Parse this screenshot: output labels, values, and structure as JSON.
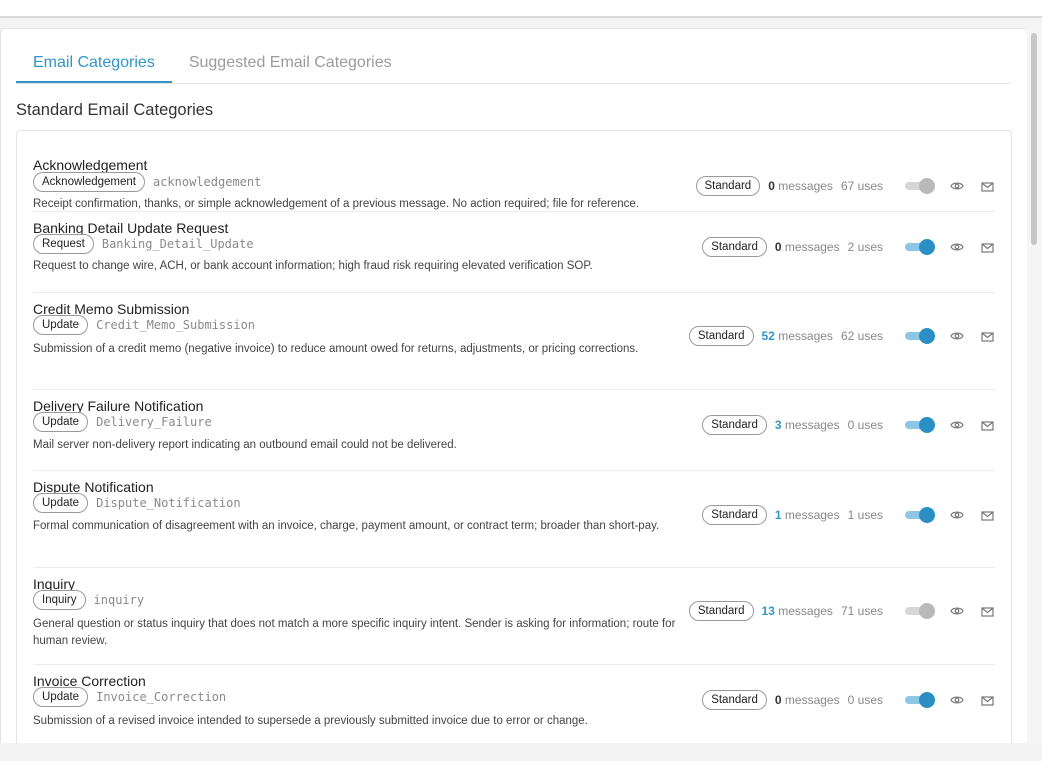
{
  "tabs": [
    {
      "label": "Email Categories",
      "active": true
    },
    {
      "label": "Suggested Email Categories",
      "active": false
    }
  ],
  "section_title": "Standard Email Categories",
  "units": {
    "messages": "messages",
    "uses": "uses"
  },
  "categories": [
    {
      "name": "Acknowledgement",
      "type": "Acknowledgement",
      "code": "acknowledgement",
      "badge": "Standard",
      "messages": "0",
      "uses": "67",
      "enabled": false,
      "description": "Receipt confirmation, thanks, or simple acknowledgement of a previous message. No action required; file for reference."
    },
    {
      "name": "Banking Detail Update Request",
      "type": "Request",
      "code": "Banking_Detail_Update",
      "badge": "Standard",
      "messages": "0",
      "uses": "2",
      "enabled": true,
      "description": "Request to change wire, ACH, or bank account information; high fraud risk requiring elevated verification SOP."
    },
    {
      "name": "Credit Memo Submission",
      "type": "Update",
      "code": "Credit_Memo_Submission",
      "badge": "Standard",
      "messages": "52",
      "uses": "62",
      "enabled": true,
      "description": "Submission of a credit memo (negative invoice) to reduce amount owed for returns, adjustments, or pricing corrections."
    },
    {
      "name": "Delivery Failure Notification",
      "type": "Update",
      "code": "Delivery_Failure",
      "badge": "Standard",
      "messages": "3",
      "uses": "0",
      "enabled": true,
      "description": "Mail server non-delivery report indicating an outbound email could not be delivered."
    },
    {
      "name": "Dispute Notification",
      "type": "Update",
      "code": "Dispute_Notification",
      "badge": "Standard",
      "messages": "1",
      "uses": "1",
      "enabled": true,
      "description": "Formal communication of disagreement with an invoice, charge, payment amount, or contract term; broader than short-pay."
    },
    {
      "name": "Inquiry",
      "type": "Inquiry",
      "code": "inquiry",
      "badge": "Standard",
      "messages": "13",
      "uses": "71",
      "enabled": false,
      "description": "General question or status inquiry that does not match a more specific inquiry intent. Sender is asking for information; route for human review."
    },
    {
      "name": "Invoice Correction",
      "type": "Update",
      "code": "Invoice_Correction",
      "badge": "Standard",
      "messages": "0",
      "uses": "0",
      "enabled": true,
      "description": "Submission of a revised invoice intended to supersede a previously submitted invoice due to error or change."
    }
  ]
}
